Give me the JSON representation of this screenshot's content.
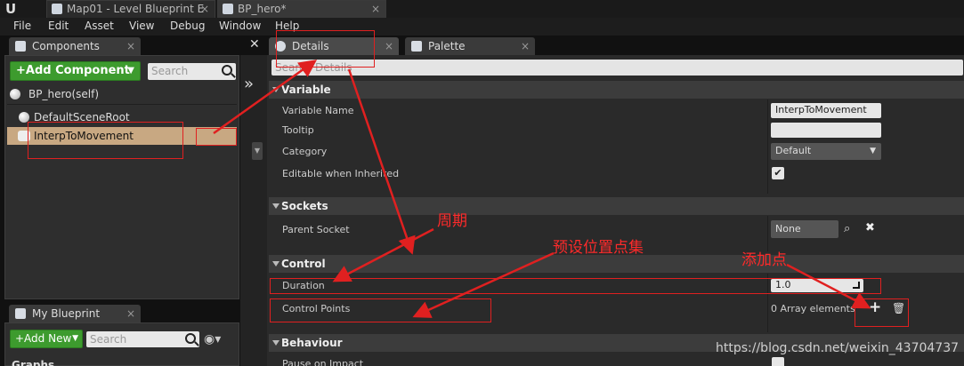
{
  "window": {
    "tabs": [
      {
        "label": "Map01 - Level Blueprint E"
      },
      {
        "label": "BP_hero*"
      }
    ]
  },
  "menu": [
    "File",
    "Edit",
    "Asset",
    "View",
    "Debug",
    "Window",
    "Help"
  ],
  "components_panel": {
    "tab_label": "Components",
    "add_button": "+Add Component",
    "search_placeholder": "Search",
    "self_item": "BP_hero(self)",
    "items": [
      "DefaultSceneRoot",
      "InterpToMovement"
    ],
    "selected": "InterpToMovement"
  },
  "my_blueprint_panel": {
    "tab_label": "My Blueprint",
    "add_button": "+Add New",
    "search_placeholder": "Search",
    "cut_text": "Graphs"
  },
  "details_panel": {
    "tabs": [
      {
        "label": "Details"
      },
      {
        "label": "Palette"
      }
    ],
    "search_placeholder": "Search Details",
    "sections": {
      "variable": {
        "title": "Variable",
        "rows": {
          "name_label": "Variable Name",
          "name_value": "InterpToMovement",
          "tooltip_label": "Tooltip",
          "tooltip_value": "",
          "category_label": "Category",
          "category_value": "Default",
          "editable_label": "Editable when Inherited",
          "editable_checked": true
        }
      },
      "sockets": {
        "title": "Sockets",
        "parent_socket_label": "Parent Socket",
        "parent_socket_value": "None"
      },
      "control": {
        "title": "Control",
        "duration_label": "Duration",
        "duration_value": "1.0",
        "control_points_label": "Control Points",
        "control_points_value": "0 Array elements"
      },
      "behaviour": {
        "title": "Behaviour",
        "pause_label": "Pause on Impact"
      }
    }
  },
  "annotations": {
    "period": "周期",
    "preset_points": "预设位置点集",
    "add_point": "添加点"
  },
  "watermark": "https://blog.csdn.net/weixin_43704737",
  "colors": {
    "annotation": "#e02020",
    "selection": "#c8a882",
    "add_button": "#3d9b2e"
  }
}
